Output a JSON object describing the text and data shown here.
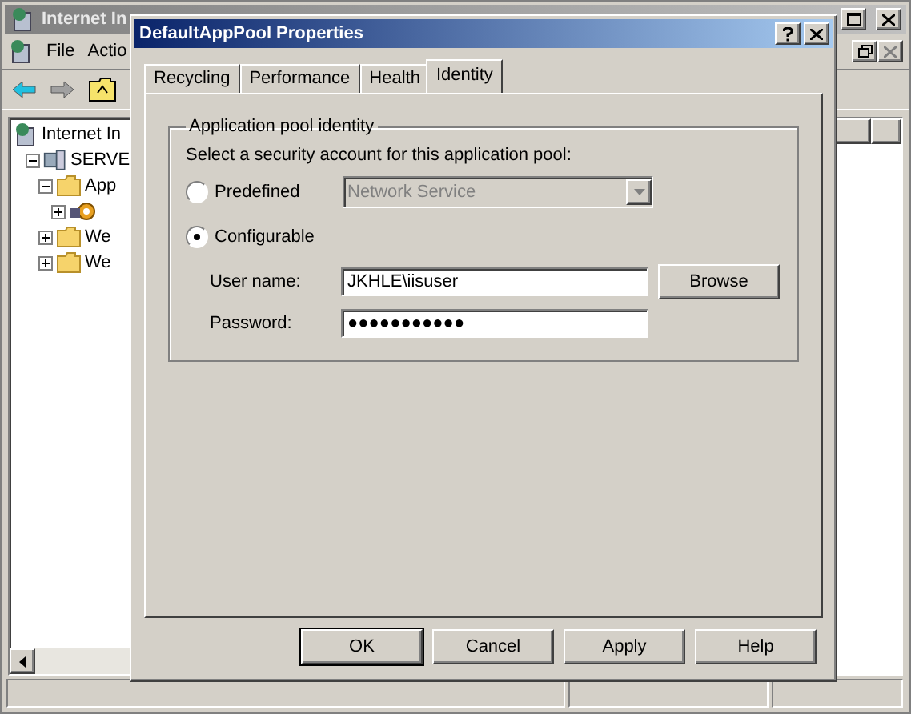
{
  "main_window": {
    "title": "Internet In",
    "menu": [
      "File",
      "Actio"
    ],
    "tree": [
      {
        "label": "Internet In",
        "kind": "iis",
        "children": [
          {
            "label": "SERVE",
            "kind": "server",
            "expanded": true,
            "children": [
              {
                "label": "App",
                "kind": "folder",
                "expanded": true,
                "children": [
                  {
                    "kind": "gear",
                    "expanded": false
                  }
                ]
              },
              {
                "label": "We",
                "kind": "folder",
                "expanded": false
              },
              {
                "label": "We",
                "kind": "folder",
                "expanded": false
              }
            ]
          }
        ]
      }
    ]
  },
  "dialog": {
    "title": "DefaultAppPool Properties",
    "tabs": [
      {
        "label": "Recycling",
        "selected": false
      },
      {
        "label": "Performance",
        "selected": false
      },
      {
        "label": "Health",
        "selected": false
      },
      {
        "label": "Identity",
        "selected": true
      }
    ],
    "group_title": "Application pool identity",
    "prompt": "Select a security account for this application pool:",
    "predefined": {
      "label": "Predefined",
      "selected": false,
      "dropdown": {
        "value": "Network Service",
        "disabled": true
      }
    },
    "configurable": {
      "label": "Configurable",
      "selected": true
    },
    "fields": [
      {
        "label": "User name:",
        "value": "JKHLE\\iisuser"
      },
      {
        "label": "Password:",
        "value": "●●●●●●●●●●●"
      }
    ],
    "browse_button": "Browse",
    "buttons": [
      {
        "label": "OK",
        "default": true
      },
      {
        "label": "Cancel",
        "default": false
      },
      {
        "label": "Apply",
        "default": false
      },
      {
        "label": "Help",
        "default": false
      }
    ]
  }
}
